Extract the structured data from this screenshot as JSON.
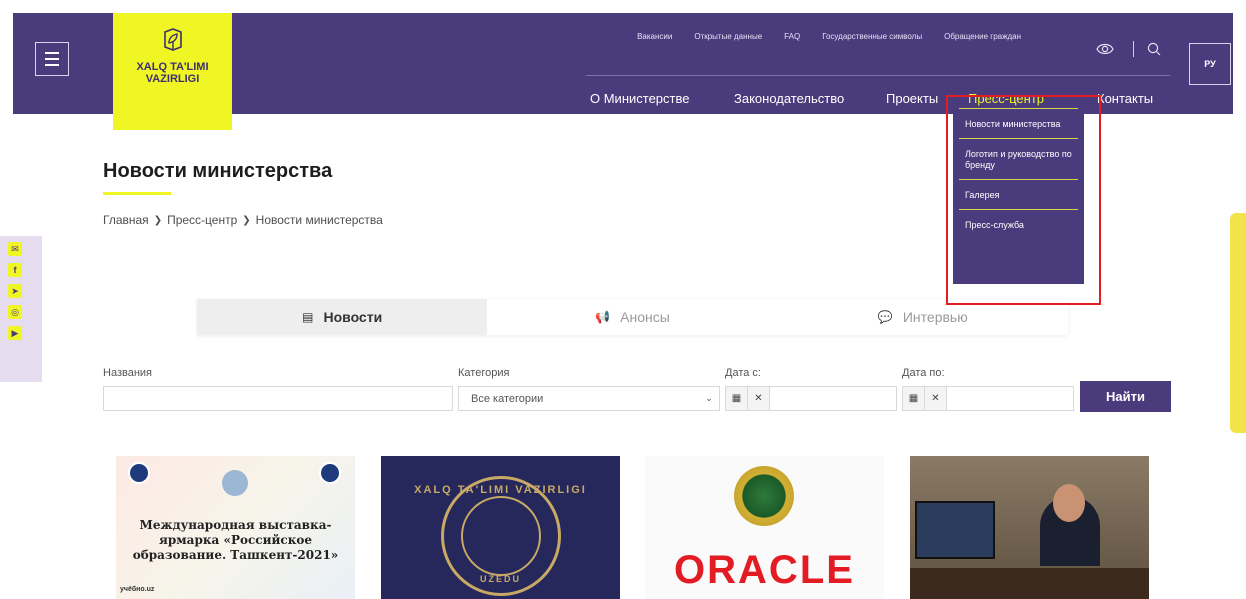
{
  "header": {
    "logo_line1": "XALQ TA'LIMI",
    "logo_line2": "VAZIRLIGI",
    "top_links": [
      "Вакансии",
      "Открытые данные",
      "FAQ",
      "Государственные символы",
      "Обращение граждан"
    ],
    "main_nav": [
      "О Министерстве",
      "Законодательство",
      "Проекты",
      "Пресс-центр",
      "Контакты"
    ],
    "active_nav": "Пресс-центр",
    "language": "РУ"
  },
  "dropdown": {
    "items": [
      "Новости министерства",
      "Логотип и руководство по бренду",
      "Галерея",
      "Пресс-служба"
    ]
  },
  "page": {
    "title": "Новости министерства",
    "breadcrumb": [
      "Главная",
      "Пресс-центр",
      "Новости министерства"
    ]
  },
  "tabs": [
    {
      "label": "Новости",
      "active": true
    },
    {
      "label": "Анонсы",
      "active": false
    },
    {
      "label": "Интервью",
      "active": false
    }
  ],
  "filters": {
    "name_label": "Названия",
    "name_value": "",
    "category_label": "Категория",
    "category_value": "Все категории",
    "date_from_label": "Дата с:",
    "date_to_label": "Дата по:",
    "submit": "Найти"
  },
  "cards": {
    "card1_text": "Международная выставка-ярмарка «Российское образование. Ташкент-2021»",
    "card1_small": "учёбно.uz",
    "card2_ring": "XALQ TA'LIMI VAZIRLIGI",
    "card2_bottom": "UZEDU",
    "card3_word": "ORACLE"
  },
  "colors": {
    "brand_purple": "#4a3b7c",
    "brand_yellow": "#f0f524",
    "highlight_red": "#e31c23"
  }
}
